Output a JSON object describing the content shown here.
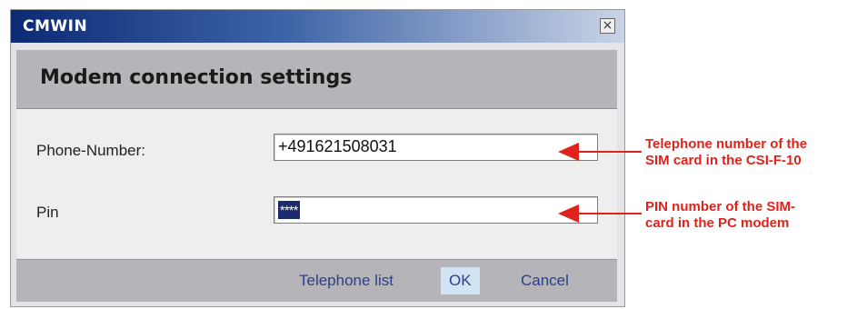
{
  "window": {
    "title": "CMWIN",
    "close_glyph": "×"
  },
  "header": {
    "title": "Modem connection settings"
  },
  "form": {
    "phone_label": "Phone-Number:",
    "phone_value": "+491621508031",
    "pin_label": "Pin",
    "pin_value": "****"
  },
  "footer": {
    "telephone_list_label": "Telephone list",
    "ok_label": "OK",
    "cancel_label": "Cancel"
  },
  "annotations": {
    "phone_line1": "Telephone number of the",
    "phone_line2": "SIM card in the CSI-F-10",
    "pin_line1": "PIN number of the SIM-",
    "pin_line2": "card in the PC modem",
    "color": "#e0231a"
  },
  "icons": {
    "close": "close-icon",
    "arrow": "arrow-left-icon"
  }
}
